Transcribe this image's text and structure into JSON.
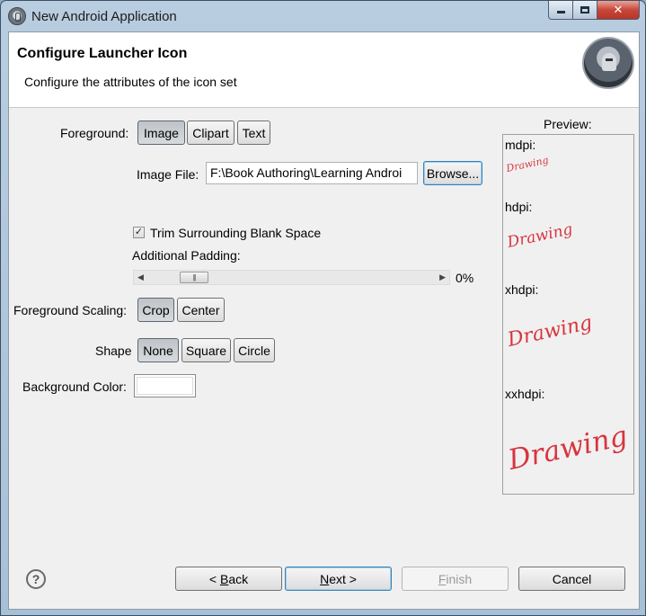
{
  "window": {
    "title": "New Android Application",
    "controls": {
      "minimize_icon": "minimize-icon",
      "maximize_icon": "maximize-icon",
      "close_icon": "close-icon",
      "close_glyph": "✕"
    }
  },
  "header": {
    "title": "Configure Launcher Icon",
    "description": "Configure the attributes of the icon set"
  },
  "foreground": {
    "label": "Foreground:",
    "options": [
      "Image",
      "Clipart",
      "Text"
    ],
    "selected": "Image"
  },
  "image_file": {
    "label": "Image File:",
    "value": "F:\\Book Authoring\\Learning Androi",
    "browse_label": "Browse..."
  },
  "trim": {
    "label": "Trim Surrounding Blank Space",
    "checked": true,
    "check_glyph": "✓"
  },
  "padding": {
    "label": "Additional Padding:",
    "value_text": "0%",
    "value": 0,
    "left_arrow": "◀",
    "right_arrow": "▶",
    "thumb_grip": "|||"
  },
  "scaling": {
    "label": "Foreground Scaling:",
    "options": [
      "Crop",
      "Center"
    ],
    "selected": "Crop"
  },
  "shape": {
    "label": "Shape",
    "options": [
      "None",
      "Square",
      "Circle"
    ],
    "selected": "None"
  },
  "background_color": {
    "label": "Background Color:",
    "value": "#ffffff"
  },
  "preview": {
    "title": "Preview:",
    "densities": [
      {
        "label": "mdpi:",
        "image_text": "Drawing"
      },
      {
        "label": "hdpi:",
        "image_text": "Drawing"
      },
      {
        "label": "xhdpi:",
        "image_text": "Drawing"
      },
      {
        "label": "xxhdpi:",
        "image_text": "Drawing"
      }
    ],
    "ink_color": "#d8343f"
  },
  "footer": {
    "help_glyph": "?",
    "back": {
      "prefix": "< ",
      "accel": "B",
      "rest": "ack"
    },
    "next": {
      "accel": "N",
      "rest": "ext >"
    },
    "finish": {
      "accel": "F",
      "rest": "inish",
      "enabled": false
    },
    "cancel": "Cancel"
  }
}
